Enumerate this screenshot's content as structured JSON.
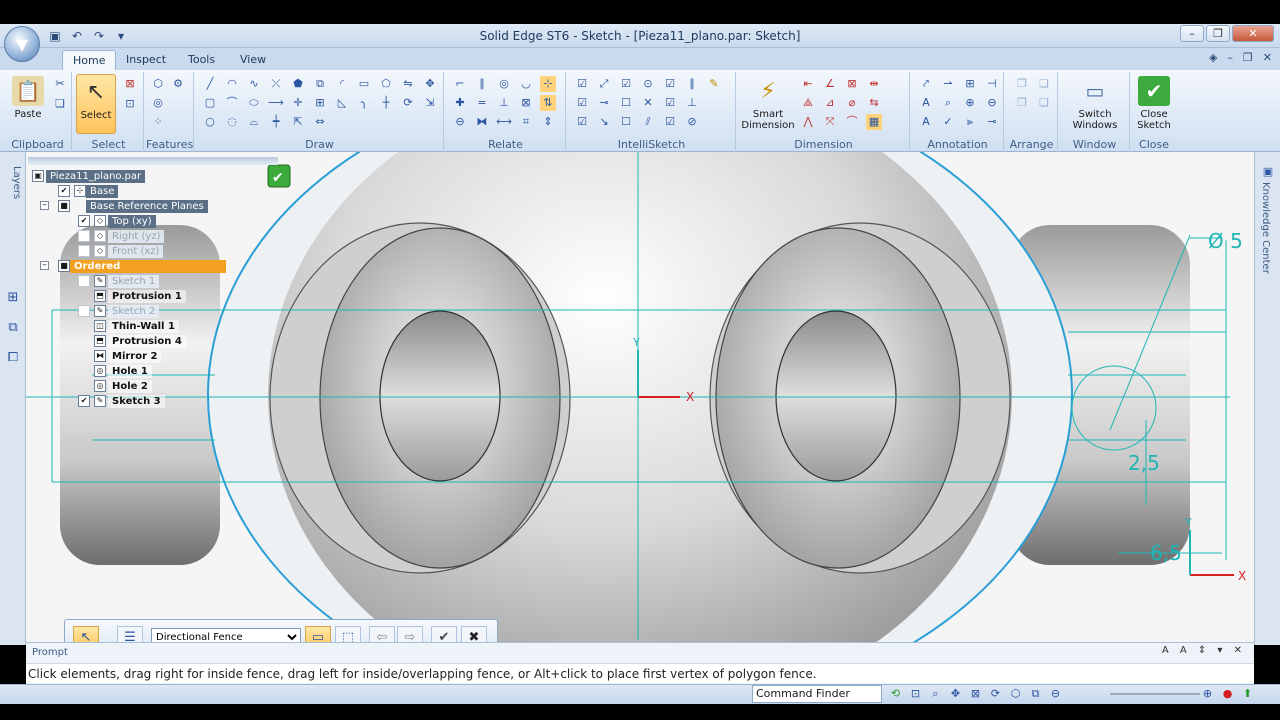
{
  "window": {
    "title": "Solid Edge ST6 - Sketch - [Pieza11_plano.par: Sketch]"
  },
  "tabs": [
    {
      "label": "Home",
      "active": true
    },
    {
      "label": "Inspect"
    },
    {
      "label": "Tools"
    },
    {
      "label": "View"
    }
  ],
  "ribbon": {
    "clipboard": {
      "paste_label": "Paste",
      "group_label": "Clipboard"
    },
    "select": {
      "select_label": "Select",
      "group_label": "Select"
    },
    "features": {
      "group_label": "Features"
    },
    "draw": {
      "group_label": "Draw"
    },
    "relate": {
      "group_label": "Relate"
    },
    "intellisketch": {
      "group_label": "IntelliSketch"
    },
    "dimension": {
      "smart_label_1": "Smart",
      "smart_label_2": "Dimension",
      "group_label": "Dimension"
    },
    "annotation": {
      "group_label": "Annotation"
    },
    "arrange": {
      "group_label": "Arrange"
    },
    "window": {
      "switch_label_1": "Switch",
      "switch_label_2": "Windows",
      "group_label": "Window"
    },
    "close": {
      "close_label_1": "Close",
      "close_label_2": "Sketch",
      "group_label": "Close"
    }
  },
  "docks": {
    "left_tab": "Layers",
    "right_tab": "Knowledge Center"
  },
  "tree": {
    "root": "Pieza11_plano.par",
    "base": "Base",
    "base_planes": "Base Reference Planes",
    "top": "Top (xy)",
    "right": "Right (yz)",
    "front": "Front (xz)",
    "ordered": "Ordered",
    "sketch1": "Sketch 1",
    "protrusion1": "Protrusion 1",
    "sketch2": "Sketch 2",
    "thinwall1": "Thin-Wall 1",
    "protrusion4": "Protrusion 4",
    "mirror2": "Mirror 2",
    "hole1": "Hole 1",
    "hole2": "Hole 2",
    "sketch3": "Sketch 3"
  },
  "drawing": {
    "dim_diameter": "Ø 5",
    "dim_2_5": "2,5",
    "dim_6_5": "6,5",
    "axis_x": "X",
    "axis_y": "Y",
    "accent": "#1fb5b5",
    "red_axis": "#d62020"
  },
  "command_bar": {
    "fence_mode": "Directional Fence",
    "fence_options": [
      "Directional Fence",
      "Inside",
      "Overlapping"
    ]
  },
  "prompt": {
    "title": "Prompt",
    "text": "Click elements, drag right for inside fence, drag left for inside/overlapping fence, or Alt+click to place first vertex of polygon fence."
  },
  "status": {
    "command_finder": "Command Finder"
  }
}
